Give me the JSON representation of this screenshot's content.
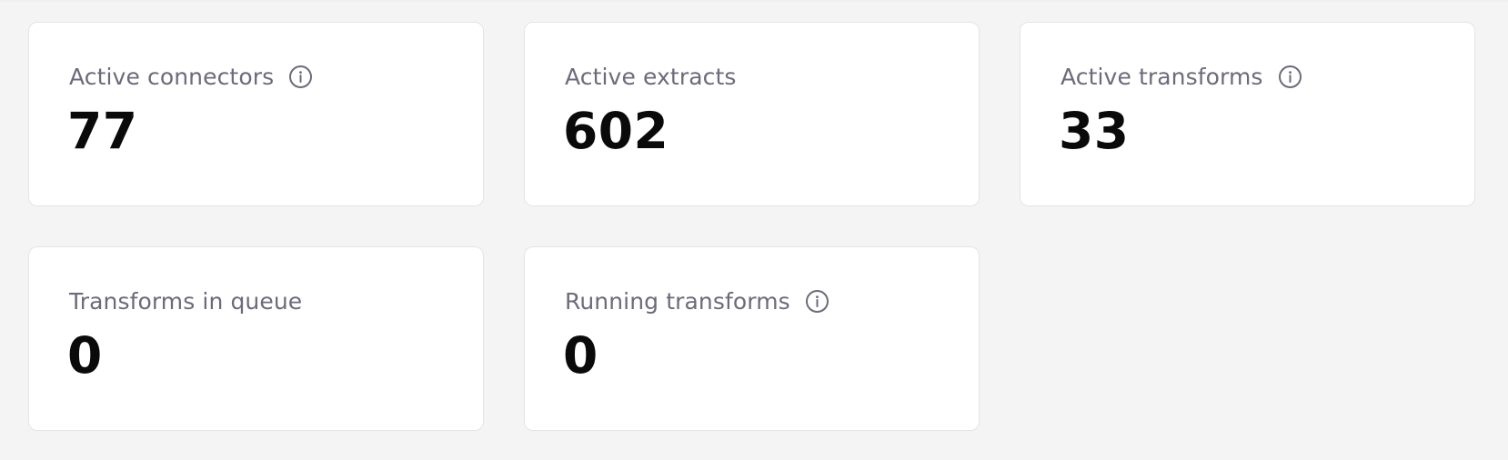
{
  "metrics": [
    {
      "label": "Active connectors",
      "value": "77",
      "has_info": true,
      "info_icon": "info-icon"
    },
    {
      "label": "Active extracts",
      "value": "602",
      "has_info": false
    },
    {
      "label": "Active transforms",
      "value": "33",
      "has_info": true,
      "info_icon": "info-icon"
    },
    {
      "label": "Transforms in queue",
      "value": "0",
      "has_info": false
    },
    {
      "label": "Running transforms",
      "value": "0",
      "has_info": true,
      "info_icon": "info-icon"
    }
  ],
  "colors": {
    "background": "#f4f4f4",
    "card": "#ffffff",
    "label": "#6b6b7b",
    "value": "#0a0a0a",
    "border": "#e4e4e7"
  }
}
